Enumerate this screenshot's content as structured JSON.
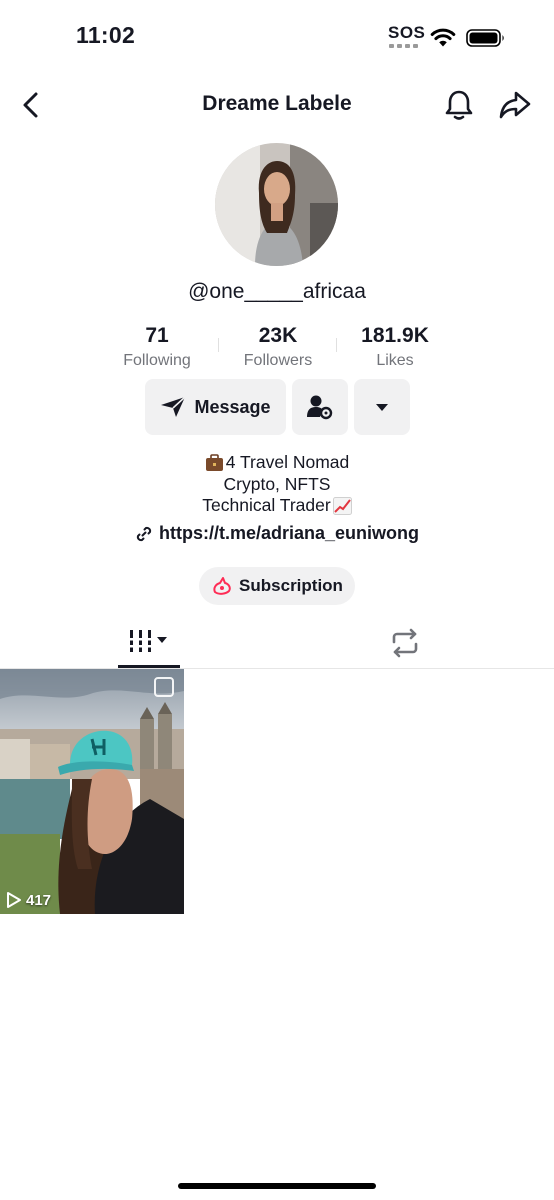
{
  "status_bar": {
    "time": "11:02",
    "sos": "SOS",
    "icons": [
      "wifi-icon",
      "battery-icon"
    ]
  },
  "header": {
    "title": "Dreame Labele",
    "icons": [
      "back-arrow-icon",
      "bell-icon",
      "share-icon"
    ]
  },
  "profile": {
    "username": "@one_____africaa",
    "stats": [
      {
        "value": "71",
        "label": "Following"
      },
      {
        "value": "23K",
        "label": "Followers"
      },
      {
        "value": "181.9K",
        "label": "Likes"
      }
    ]
  },
  "actions": {
    "message_label": "Message",
    "icons": [
      "send-icon",
      "user-settings-icon",
      "caret-down-icon"
    ]
  },
  "bio": {
    "lines": [
      "4 Travel Nomad",
      "Crypto, NFTS",
      "Technical Trader"
    ],
    "emojis": [
      "briefcase-icon",
      "chart-increasing-icon"
    ],
    "link": "https://t.me/adriana_euniwong"
  },
  "subscription": {
    "label": "Subscription"
  },
  "tabs": {
    "items": [
      "videos-grid-icon",
      "repost-icon"
    ],
    "active": "videos-grid-icon"
  },
  "videos": [
    {
      "views": "417"
    }
  ],
  "colors": {
    "text": "#161823",
    "secondary_text": "#72747a",
    "button_bg": "#f1f1f2",
    "subscription_icon": "#fe2c55"
  }
}
